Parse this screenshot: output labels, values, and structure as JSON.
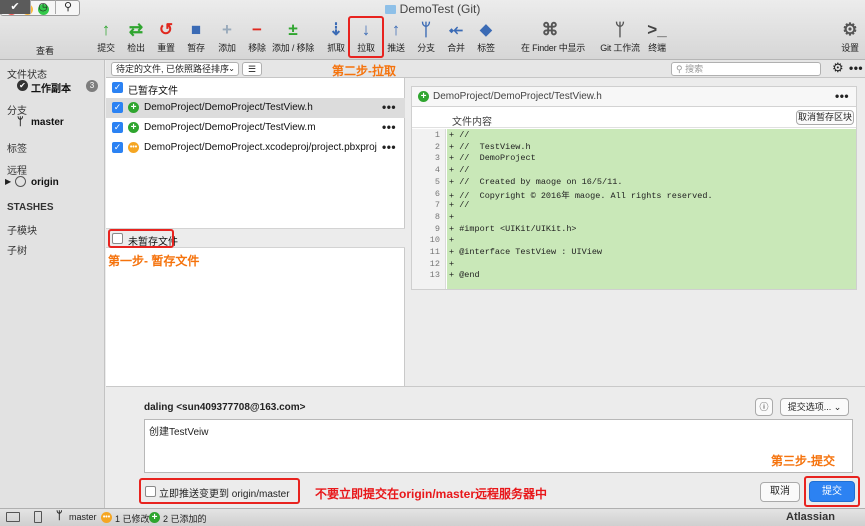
{
  "window": {
    "title": "DemoTest (Git)"
  },
  "toolbar": {
    "view_label": "查看",
    "buttons": [
      {
        "label": "提交",
        "icon": "commit-icon"
      },
      {
        "label": "检出",
        "icon": "checkout-icon"
      },
      {
        "label": "重置",
        "icon": "reset-icon"
      },
      {
        "label": "暂存",
        "icon": "stash-icon"
      },
      {
        "label": "添加",
        "icon": "add-icon"
      },
      {
        "label": "移除",
        "icon": "remove-icon"
      },
      {
        "label": "添加 / 移除",
        "icon": "add-remove-icon"
      },
      {
        "label": "抓取",
        "icon": "fetch-icon"
      },
      {
        "label": "拉取",
        "icon": "pull-icon"
      },
      {
        "label": "推送",
        "icon": "push-icon"
      },
      {
        "label": "分支",
        "icon": "branch-icon"
      },
      {
        "label": "合并",
        "icon": "merge-icon"
      },
      {
        "label": "标签",
        "icon": "tag-icon"
      },
      {
        "label": "在 Finder 中显示",
        "icon": "finder-icon"
      },
      {
        "label": "Git 工作流",
        "icon": "git-flow-icon"
      },
      {
        "label": "终端",
        "icon": "terminal-icon"
      },
      {
        "label": "设置",
        "icon": "settings-icon"
      }
    ]
  },
  "sidebar": {
    "file_status_header": "文件状态",
    "working_copy": "工作副本",
    "working_copy_count": "3",
    "branches_header": "分支",
    "branch": "master",
    "tags_header": "标签",
    "remotes_header": "远程",
    "remote": "origin",
    "stashes_header": "STASHES",
    "submodules_header": "子模块",
    "subtrees_header": "子树"
  },
  "filters": {
    "sort": "待定的文件, 已依照路径排序",
    "search_placeholder": "搜索"
  },
  "files": {
    "staged_header": "已暂存文件",
    "unstaged_header": "未暂存文件",
    "list": [
      {
        "name": "DemoProject/DemoProject/TestView.h",
        "status": "added",
        "color": "#2fa52f"
      },
      {
        "name": "DemoProject/DemoProject/TestView.m",
        "status": "added",
        "color": "#2fa52f"
      },
      {
        "name": "DemoProject/DemoProject.xcodeproj/project.pbxproj",
        "status": "modified",
        "color": "#f5a623"
      }
    ]
  },
  "diff": {
    "file": "DemoProject/DemoProject/TestView.h",
    "hunk_label": "文件内容",
    "unstage_hunk": "取消暂存区块",
    "lines": [
      {
        "n": "1",
        "text": "+ //"
      },
      {
        "n": "2",
        "text": "+ //  TestView.h"
      },
      {
        "n": "3",
        "text": "+ //  DemoProject"
      },
      {
        "n": "4",
        "text": "+ //"
      },
      {
        "n": "5",
        "text": "+ //  Created by maoge on 16/5/11."
      },
      {
        "n": "6",
        "text": "+ //  Copyright © 2016年 maoge. All rights reserved."
      },
      {
        "n": "7",
        "text": "+ //"
      },
      {
        "n": "8",
        "text": "+"
      },
      {
        "n": "9",
        "text": "+ #import <UIKit/UIKit.h>"
      },
      {
        "n": "10",
        "text": "+"
      },
      {
        "n": "11",
        "text": "+ @interface TestView : UIView"
      },
      {
        "n": "12",
        "text": "+"
      },
      {
        "n": "13",
        "text": "+ @end"
      }
    ],
    "added_color": "#c9e8b8"
  },
  "commit": {
    "author": "daling <sun409377708@163.com>",
    "options": "提交选项...",
    "message": "创建TestVeiw",
    "push_label": "立即推送变更到 origin/master",
    "cancel": "取消",
    "submit": "提交"
  },
  "statusbar": {
    "branch": "master",
    "modified": "1 已修改",
    "added": "2 已添加的",
    "brand": "Atlassian"
  },
  "annotations": {
    "step1": "第一步- 暂存文件",
    "step2": "第二步-拉取",
    "step3": "第三步-提交",
    "note": "不要立即提交在origin/master远程服务器中"
  }
}
